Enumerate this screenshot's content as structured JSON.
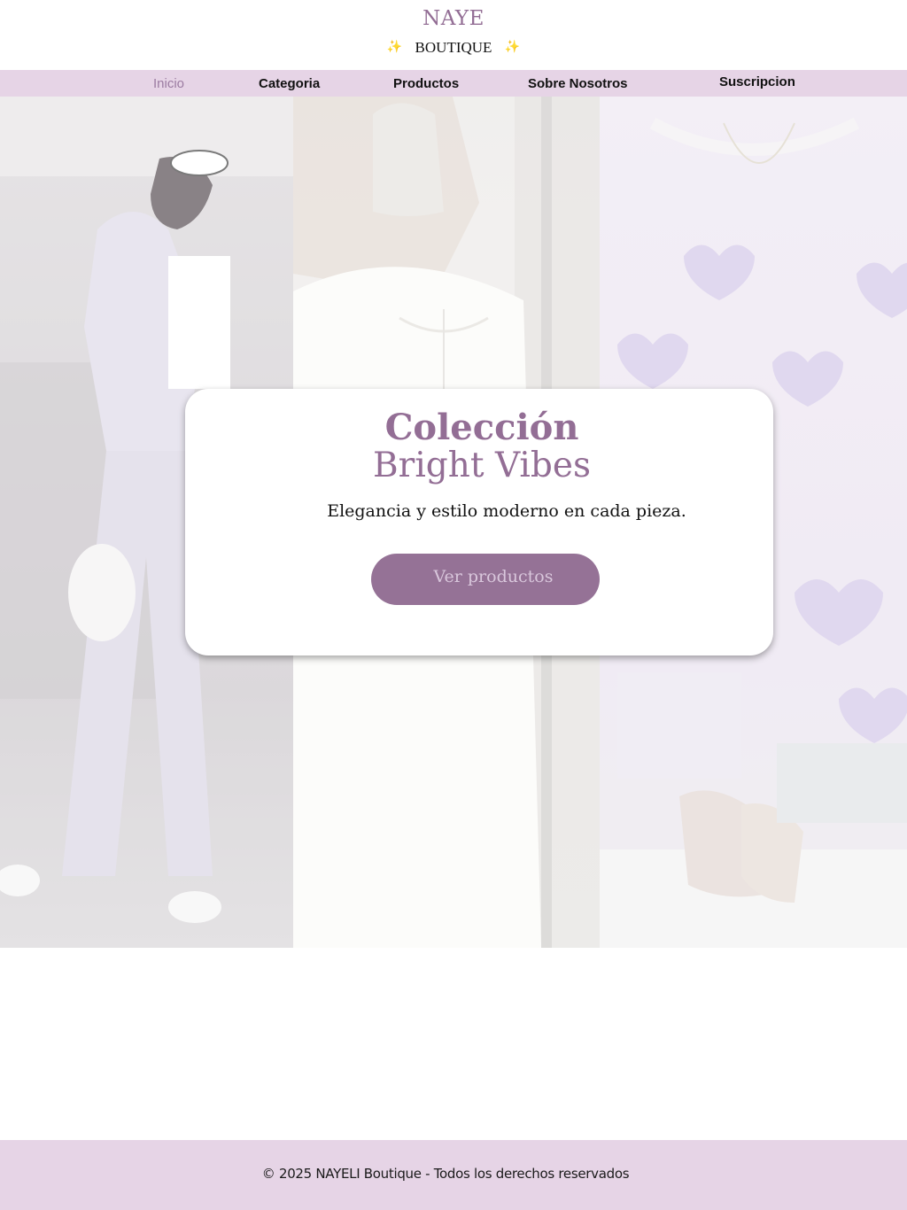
{
  "header": {
    "logo_main": "NAYE",
    "logo_sub": "BOUTIQUE",
    "sparkle": "✨"
  },
  "nav": {
    "items": [
      {
        "label": "Inicio",
        "active": true
      },
      {
        "label": "Categoria"
      },
      {
        "label": "Productos"
      },
      {
        "label": "Sobre Nosotros"
      },
      {
        "label": "Suscripcion"
      }
    ]
  },
  "hero": {
    "panels": [
      "fashion-photo-outfit",
      "fashion-photo-hoodie",
      "fashion-photo-sweater"
    ],
    "title_line1": "Colección",
    "title_line2": "Bright Vibes",
    "subtitle": "Elegancia y estilo moderno en cada pieza.",
    "cta_label": "Ver productos"
  },
  "footer": {
    "text": "© 2025 NAYELI Boutique - Todos los derechos reservados"
  },
  "colors": {
    "brand": "#936e95",
    "nav_bg": "#e6d4e6",
    "button": "#957296",
    "button_text": "#d9c7dc"
  }
}
